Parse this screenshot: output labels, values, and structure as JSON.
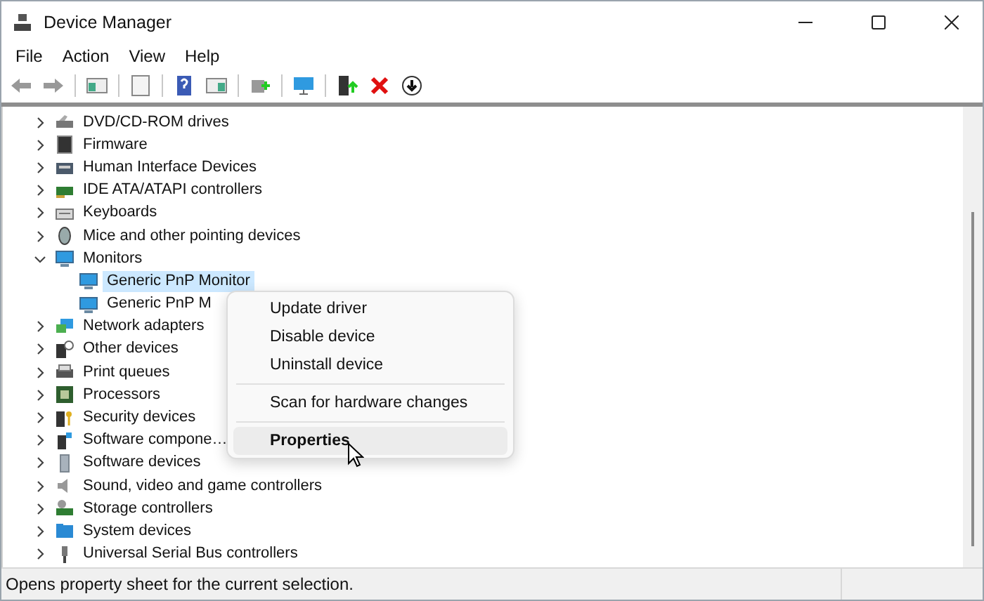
{
  "window": {
    "title": "Device Manager"
  },
  "menu": [
    "File",
    "Action",
    "View",
    "Help"
  ],
  "tree": [
    {
      "label": "DVD/CD-ROM drives",
      "expanded": false,
      "selected": false
    },
    {
      "label": "Firmware",
      "expanded": false,
      "selected": false
    },
    {
      "label": "Human Interface Devices",
      "expanded": false,
      "selected": false
    },
    {
      "label": "IDE ATA/ATAPI controllers",
      "expanded": false,
      "selected": false
    },
    {
      "label": "Keyboards",
      "expanded": false,
      "selected": false
    },
    {
      "label": "Mice and other pointing devices",
      "expanded": false,
      "selected": false
    },
    {
      "label": "Monitors",
      "expanded": true,
      "selected": false,
      "children": [
        {
          "label": "Generic PnP Monitor",
          "selected": true
        },
        {
          "label": "Generic PnP M",
          "selected": false
        }
      ]
    },
    {
      "label": "Network adapters",
      "expanded": false,
      "selected": false
    },
    {
      "label": "Other devices",
      "expanded": false,
      "selected": false
    },
    {
      "label": "Print queues",
      "expanded": false,
      "selected": false
    },
    {
      "label": "Processors",
      "expanded": false,
      "selected": false
    },
    {
      "label": "Security devices",
      "expanded": false,
      "selected": false
    },
    {
      "label": "Software compone…",
      "expanded": false,
      "selected": false
    },
    {
      "label": "Software devices",
      "expanded": false,
      "selected": false
    },
    {
      "label": "Sound, video and game controllers",
      "expanded": false,
      "selected": false
    },
    {
      "label": "Storage controllers",
      "expanded": false,
      "selected": false
    },
    {
      "label": "System devices",
      "expanded": false,
      "selected": false
    },
    {
      "label": "Universal Serial Bus controllers",
      "expanded": false,
      "selected": false
    }
  ],
  "context_menu": {
    "groups": [
      [
        {
          "label": "Update driver",
          "selected": false,
          "default": false
        },
        {
          "label": "Disable device",
          "selected": false,
          "default": false
        },
        {
          "label": "Uninstall device",
          "selected": false,
          "default": false
        }
      ],
      [
        {
          "label": "Scan for hardware changes",
          "selected": false,
          "default": false
        }
      ],
      [
        {
          "label": "Properties",
          "selected": true,
          "default": true
        }
      ]
    ]
  },
  "status_bar": {
    "text": "Opens property sheet for the current selection."
  }
}
